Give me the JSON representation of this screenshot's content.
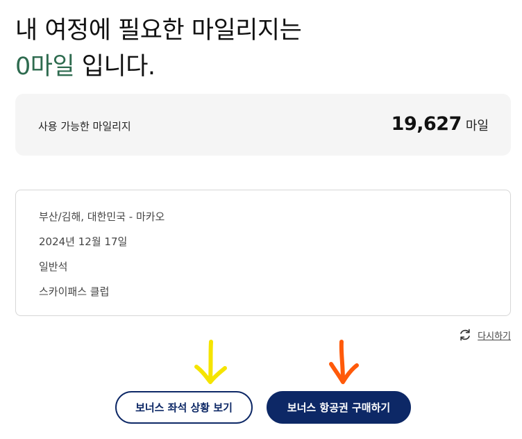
{
  "headline": {
    "line1": "내 여정에 필요한 마일리지는",
    "miles_needed": "0마일",
    "suffix": " 입니다."
  },
  "balance": {
    "label": "사용 가능한 마일리지",
    "value": "19,627",
    "unit": "마일"
  },
  "trip": {
    "route": "부산/김해, 대한민국 - 마카오",
    "date": "2024년 12월 17일",
    "cabin": "일반석",
    "membership": "스카이패스 클럽"
  },
  "retry": {
    "label": "다시하기",
    "icon": "refresh-icon"
  },
  "annotations": {
    "yellow_arrow_color": "#f5e400",
    "orange_arrow_color": "#ff5a0a"
  },
  "buttons": {
    "seat_status_label": "보너스 좌석 상황 보기",
    "buy_ticket_label": "보너스 항공권 구매하기"
  },
  "colors": {
    "accent_green": "#2e6b4f",
    "brand_navy": "#0d2866"
  }
}
